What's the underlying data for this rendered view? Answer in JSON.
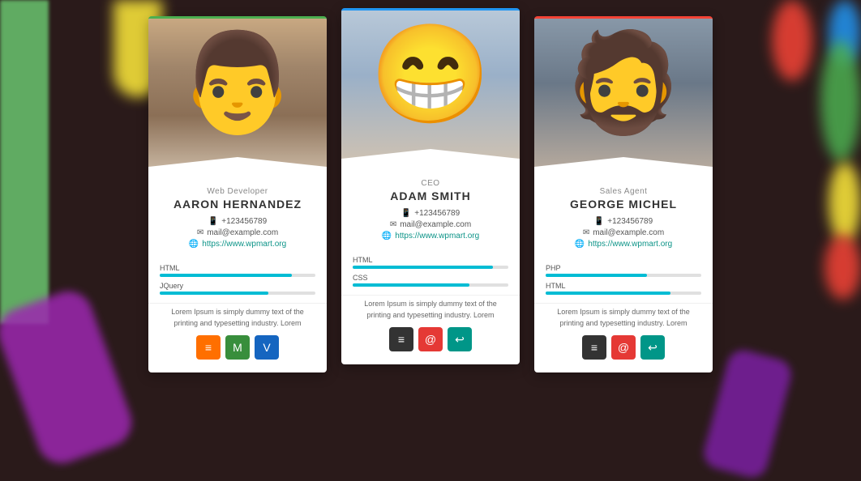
{
  "background": {
    "color": "#2a1a1a"
  },
  "cards": [
    {
      "id": "aaron",
      "role": "Web Developer",
      "name": "AARON HERNANDEZ",
      "phone": "+123456789",
      "email": "mail@example.com",
      "website": "https://www.wpmart.org",
      "skills": [
        {
          "label": "HTML",
          "percent": 85
        },
        {
          "label": "JQuery",
          "percent": 70
        }
      ],
      "description": "Lorem Ipsum is simply dummy text of the printing and typesetting industry. Lorem",
      "social": [
        {
          "icon": "≡",
          "color": "btn-orange",
          "name": "menu"
        },
        {
          "icon": "M",
          "color": "btn-green-dark",
          "name": "medium"
        },
        {
          "icon": "V",
          "color": "btn-blue-dark",
          "name": "vimeo"
        }
      ]
    },
    {
      "id": "adam",
      "role": "CEO",
      "name": "ADAM SMITH",
      "phone": "+123456789",
      "email": "mail@example.com",
      "website": "https://www.wpmart.org",
      "skills": [
        {
          "label": "HTML",
          "percent": 90
        },
        {
          "label": "CSS",
          "percent": 75
        }
      ],
      "description": "Lorem Ipsum is simply dummy text of the printing and typesetting industry. Lorem",
      "social": [
        {
          "icon": "≡",
          "color": "btn-dark",
          "name": "menu"
        },
        {
          "icon": "@",
          "color": "btn-red",
          "name": "email"
        },
        {
          "icon": "↩",
          "color": "btn-teal",
          "name": "share"
        }
      ]
    },
    {
      "id": "george",
      "role": "Sales Agent",
      "name": "GEORGE MICHEL",
      "phone": "+123456789",
      "email": "mail@example.com",
      "website": "https://www.wpmart.org",
      "skills": [
        {
          "label": "PHP",
          "percent": 65
        },
        {
          "label": "HTML",
          "percent": 80
        }
      ],
      "description": "Lorem Ipsum is simply dummy text of the printing and typesetting industry. Lorem",
      "social": [
        {
          "icon": "≡",
          "color": "btn-dark",
          "name": "menu"
        },
        {
          "icon": "@",
          "color": "btn-red",
          "name": "email"
        },
        {
          "icon": "↩",
          "color": "btn-teal",
          "name": "share"
        }
      ]
    }
  ]
}
